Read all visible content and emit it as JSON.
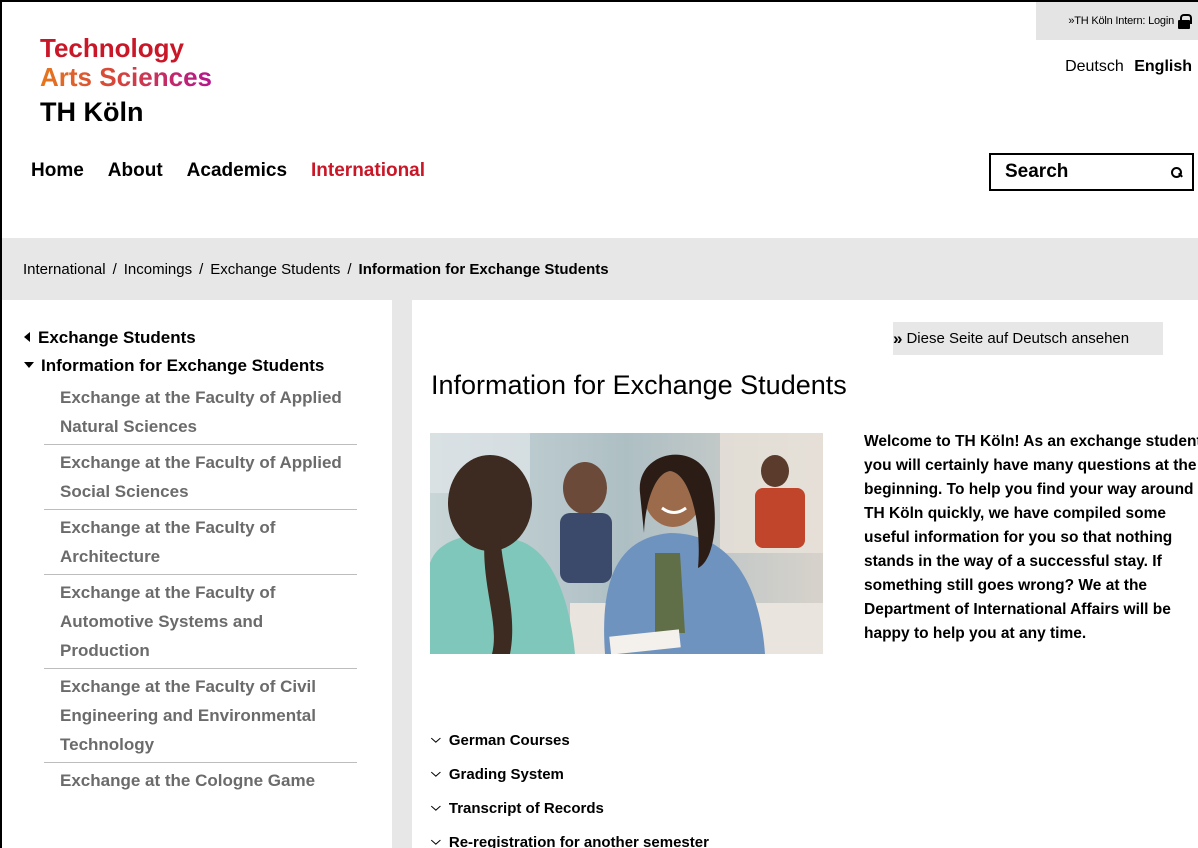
{
  "header": {
    "logo": {
      "line1": "Technology",
      "line2": "Arts Sciences",
      "line3": "TH Köln"
    },
    "login_label": "»TH Köln Intern: Login",
    "languages": [
      {
        "label": "Deutsch",
        "active": false
      },
      {
        "label": "English",
        "active": true
      }
    ],
    "nav": [
      {
        "label": "Home",
        "active": false
      },
      {
        "label": "About",
        "active": false
      },
      {
        "label": "Academics",
        "active": false
      },
      {
        "label": "International",
        "active": true
      }
    ],
    "search": {
      "placeholder": "Search",
      "value": ""
    }
  },
  "breadcrumb": {
    "items": [
      "International",
      "Incomings",
      "Exchange Students"
    ],
    "current": "Information for Exchange Students",
    "separator": "/"
  },
  "sidebar": {
    "parent": "Exchange Students",
    "current": "Information for Exchange Students",
    "children": [
      "Exchange at the Faculty of Applied Natural Sciences",
      "Exchange at the Faculty of Applied Social Sciences",
      "Exchange at the Faculty of Architecture",
      "Exchange at the Faculty of Automotive Systems and Production",
      "Exchange at the Faculty of Civil Engineering and Environmental Technology",
      "Exchange at the Cologne Game"
    ]
  },
  "main": {
    "german_link": "Diese Seite auf Deutsch ansehen",
    "title": "Information for Exchange Students",
    "intro": "Welcome to TH Köln! As an exchange student you will certainly have many questions at the beginning. To help you find your way around TH Köln quickly, we have compiled some useful information for you so that nothing stands in the way of a successful stay. If something still goes wrong? We at the Department of International Affairs will be happy to help you at any time.",
    "accordion": [
      "German Courses",
      "Grading System",
      "Transcript of Records",
      "Re-registration for another semester"
    ]
  },
  "colors": {
    "accent_red": "#c91728",
    "gradient_orange": "#e7771d",
    "gradient_magenta": "#b4158e",
    "grey_band": "#e7e7e7",
    "sidebar_text": "#6b6b6b"
  }
}
